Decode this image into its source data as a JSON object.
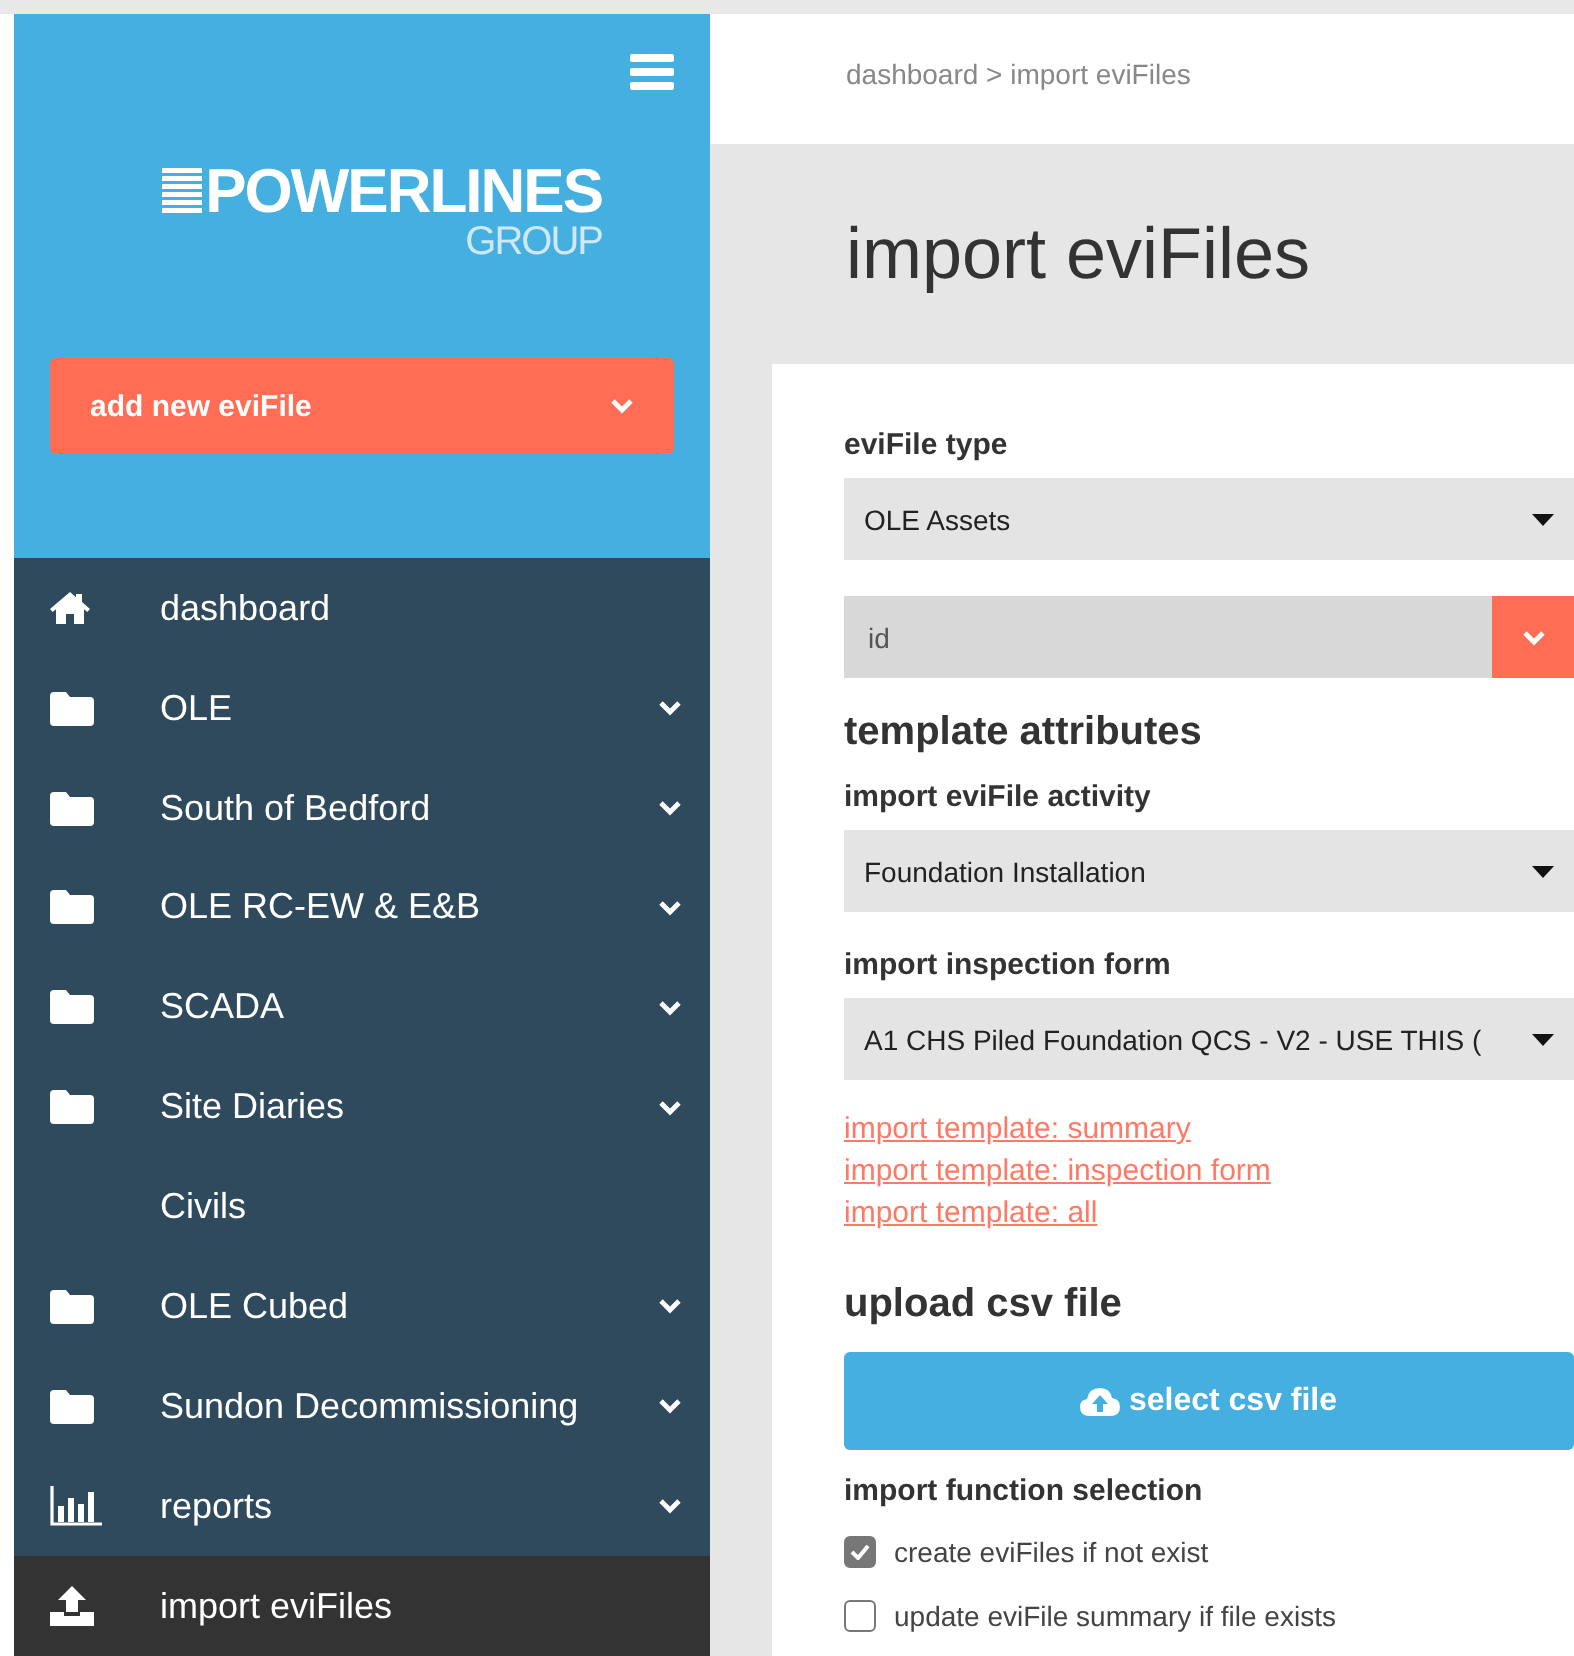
{
  "sidebar": {
    "logo": {
      "name": "POWERLINES",
      "sub": "GROUP"
    },
    "add_button": {
      "label": "add new eviFile"
    },
    "items": [
      {
        "label": "dashboard",
        "kind": "home",
        "expandable": false,
        "selected": false
      },
      {
        "label": "OLE",
        "kind": "folder",
        "expandable": true,
        "selected": false
      },
      {
        "label": "South of Bedford",
        "kind": "folder",
        "expandable": true,
        "selected": false
      },
      {
        "label": "OLE RC-EW & E&B",
        "kind": "folder",
        "expandable": true,
        "selected": false
      },
      {
        "label": "SCADA",
        "kind": "folder",
        "expandable": true,
        "selected": false
      },
      {
        "label": "Site Diaries",
        "kind": "folder",
        "expandable": true,
        "selected": false
      },
      {
        "label": "Civils",
        "kind": "plain",
        "expandable": false,
        "selected": false
      },
      {
        "label": "OLE Cubed",
        "kind": "folder",
        "expandable": true,
        "selected": false
      },
      {
        "label": "Sundon Decommissioning",
        "kind": "folder",
        "expandable": true,
        "selected": false
      },
      {
        "label": "reports",
        "kind": "chart",
        "expandable": true,
        "selected": false
      },
      {
        "label": "import eviFiles",
        "kind": "upload",
        "expandable": false,
        "selected": true
      }
    ]
  },
  "breadcrumb": "dashboard > import eviFiles",
  "page_title": "import eviFiles",
  "form": {
    "type_label": "eviFile type",
    "type_value": "OLE Assets",
    "id_field": {
      "placeholder": "id"
    },
    "section_title": "template attributes",
    "activity_label": "import eviFile activity",
    "activity_value": "Foundation Installation",
    "inspection_label": "import inspection form",
    "inspection_value": "A1 CHS Piled Foundation QCS - V2 - USE THIS (",
    "links": [
      "import template: summary",
      "import template: inspection form",
      "import template: all"
    ],
    "upload_title": "upload csv file",
    "upload_button": "select csv file",
    "function_label": "import function selection",
    "options": [
      {
        "label": "create eviFiles if not exist",
        "checked": true
      },
      {
        "label": "update eviFile summary if file exists",
        "checked": false
      }
    ]
  }
}
